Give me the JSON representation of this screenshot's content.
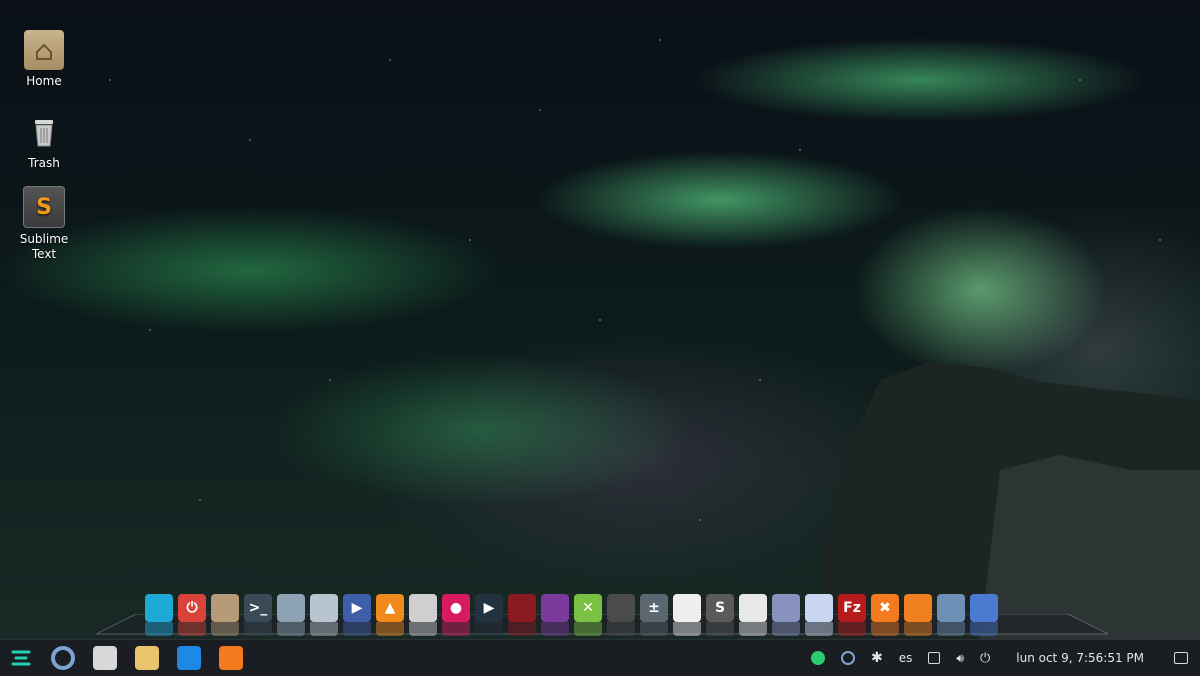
{
  "desktop": {
    "icons": [
      {
        "label": "Home",
        "icon": "home-folder-icon"
      },
      {
        "label": "Trash",
        "icon": "trash-icon"
      },
      {
        "label": "Sublime Text",
        "icon": "sublime-text-icon"
      }
    ]
  },
  "dock": {
    "items": [
      {
        "icon": "zorin-menu-icon",
        "color": "#1fa9d6"
      },
      {
        "icon": "power-icon",
        "color": "#d9433b",
        "glyph": "⏻"
      },
      {
        "icon": "archive-icon",
        "color": "#b79b78"
      },
      {
        "icon": "terminal-icon",
        "color": "#3b4a57",
        "glyph": ">_"
      },
      {
        "icon": "files-icon",
        "color": "#8da3b5"
      },
      {
        "icon": "file-search-icon",
        "color": "#b8c4cf"
      },
      {
        "icon": "media-player-icon",
        "color": "#3f5ea8",
        "glyph": "▶"
      },
      {
        "icon": "vlc-icon",
        "color": "#f08a1c",
        "glyph": "▲"
      },
      {
        "icon": "camera-icon",
        "color": "#cfcfcf"
      },
      {
        "icon": "record-icon",
        "color": "#d81b60",
        "glyph": "●"
      },
      {
        "icon": "video-player-icon",
        "color": "#22323f",
        "glyph": "▶"
      },
      {
        "icon": "video-editor-icon",
        "color": "#8a1a20"
      },
      {
        "icon": "movie-maker-icon",
        "color": "#7a3a9c"
      },
      {
        "icon": "cross-tool-icon",
        "color": "#7ac143",
        "glyph": "✕"
      },
      {
        "icon": "owl-icon",
        "color": "#4b4b4b"
      },
      {
        "icon": "calculator-icon",
        "color": "#5b6770",
        "glyph": "±"
      },
      {
        "icon": "document-icon",
        "color": "#eeeeee"
      },
      {
        "icon": "sublime-dock-icon",
        "color": "#5a5a5a",
        "glyph": "S"
      },
      {
        "icon": "text-editor-icon",
        "color": "#e8e8e8"
      },
      {
        "icon": "php-icon",
        "color": "#8892bf"
      },
      {
        "icon": "cube-icon",
        "color": "#c9d6f0"
      },
      {
        "icon": "filezilla-icon",
        "color": "#b71c1c",
        "glyph": "Fz"
      },
      {
        "icon": "xampp-icon",
        "color": "#f47a20",
        "glyph": "✖"
      },
      {
        "icon": "firefox-icon",
        "color": "#f0801f"
      },
      {
        "icon": "chromium-icon",
        "color": "#6e8fb6"
      },
      {
        "icon": "chrome-icon",
        "color": "#4a7bd0"
      }
    ]
  },
  "taskbar": {
    "launchers": [
      {
        "icon": "zorin-logo-icon",
        "color": "#1fd3b5"
      },
      {
        "icon": "chromium-taskbar-icon",
        "color": "#7ea3d1"
      },
      {
        "icon": "file-manager-taskbar-icon",
        "color": "#d8d8d8"
      },
      {
        "icon": "weather-icon",
        "color": "#e9c46a"
      },
      {
        "icon": "system-monitor-icon",
        "color": "#1e88e5"
      },
      {
        "icon": "xampp-taskbar-icon",
        "color": "#f47a20"
      }
    ],
    "tray": {
      "keyboard_layout": "es",
      "clock": "lun oct  9,  7:56:51 PM"
    }
  },
  "colors": {
    "taskbar_bg": "#1a1d22",
    "accent": "#1fd3b5"
  }
}
